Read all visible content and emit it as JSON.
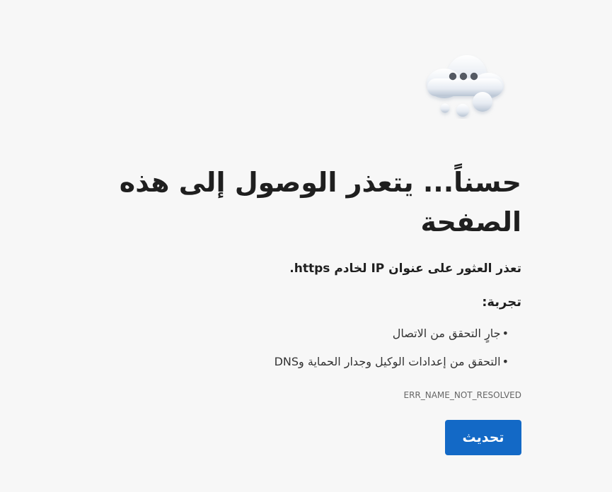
{
  "page": {
    "title": "حسناً... يتعذر الوصول إلى هذه الصفحة",
    "subtitle": "تعذر العثور على عنوان IP لخادم https.",
    "suggestions_label": "تجربة:",
    "suggestions": [
      "جارٍ التحقق من الاتصال",
      "التحقق من إعدادات الوكيل وجدار الحماية وDNS"
    ],
    "error_code": "ERR_NAME_NOT_RESOLVED",
    "refresh_label": "تحديث"
  },
  "icons": {
    "error_illustration": "cloud-icon"
  },
  "colors": {
    "background": "#f7f7f7",
    "primary": "#1369c6",
    "text": "#1f1f1f",
    "secondary_text": "#666666"
  }
}
